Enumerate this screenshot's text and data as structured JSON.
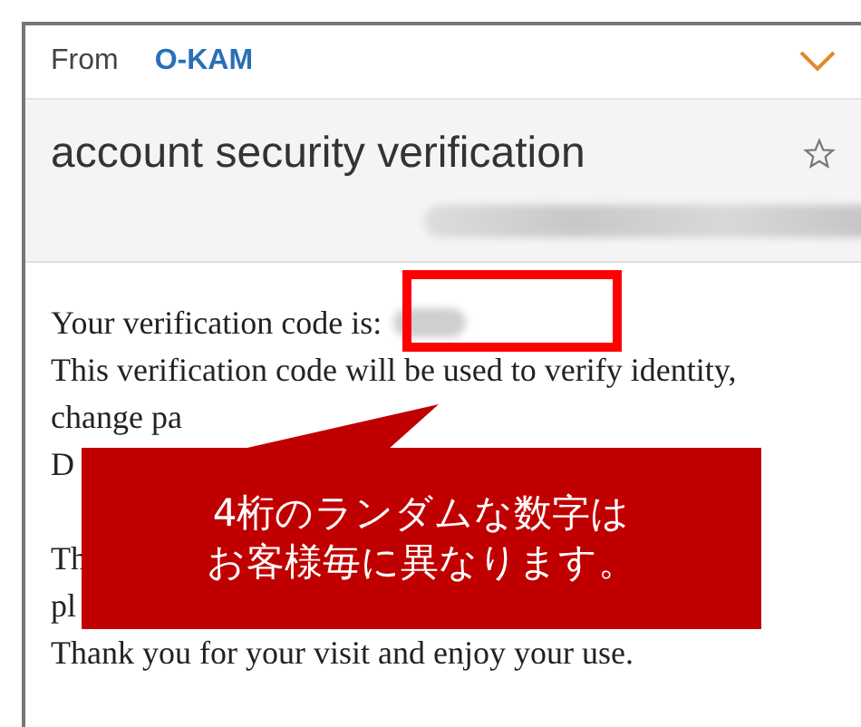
{
  "header": {
    "label": "From",
    "sender": "O-KAM"
  },
  "subject": {
    "title": "account security verification",
    "starred": false,
    "sender_redacted": true
  },
  "body": {
    "code_label": "Your verification code is:",
    "code_redacted": true,
    "lines": [
      {
        "text": "This verification code will be used to verify identity,",
        "gap_before": false
      },
      {
        "text": "change pa",
        "gap_before": false
      },
      {
        "text": "D",
        "gap_before": false
      },
      {
        "text": "Th",
        "gap_before": true
      },
      {
        "text": "pl",
        "gap_before": false
      },
      {
        "text": "Thank you for your visit and enjoy your use.",
        "gap_before": false
      }
    ]
  },
  "callout": {
    "lines": [
      "4桁のランダムな数字は",
      "お客様毎に異なります。"
    ]
  }
}
